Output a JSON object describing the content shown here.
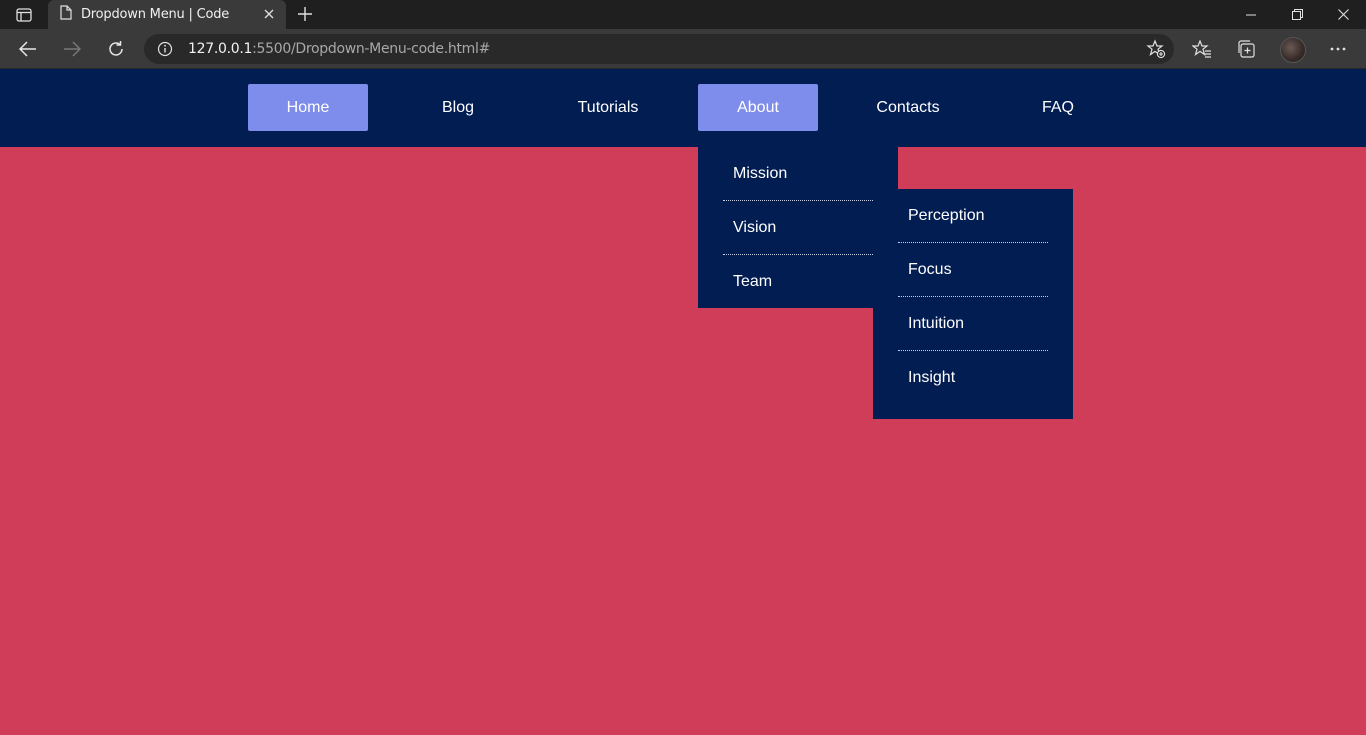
{
  "browser": {
    "tab_title": "Dropdown Menu | Code",
    "url_host": "127.0.0.1",
    "url_rest": ":5500/Dropdown-Menu-code.html#"
  },
  "icons": {
    "tab_actions": "tab-actions-icon",
    "page": "page-icon",
    "close": "close-icon",
    "new_tab": "plus-icon",
    "back": "arrow-left-icon",
    "forward": "arrow-right-icon",
    "reload": "reload-icon",
    "info": "info-icon",
    "add_favorite": "star-plus-icon",
    "favorites": "favorites-icon",
    "collections": "collections-icon",
    "menu": "ellipsis-icon"
  },
  "colors": {
    "page_background": "#d03d58",
    "navbar_background": "#021d52",
    "active_item": "#7e8ceb"
  },
  "nav": {
    "items": [
      {
        "label": "Home",
        "active": true
      },
      {
        "label": "Blog",
        "active": false
      },
      {
        "label": "Tutorials",
        "active": false
      },
      {
        "label": "About",
        "active": true
      },
      {
        "label": "Contacts",
        "active": false
      },
      {
        "label": "FAQ",
        "active": false
      }
    ]
  },
  "dropdown": {
    "items": [
      {
        "label": "Mission"
      },
      {
        "label": "Vision"
      },
      {
        "label": "Team"
      }
    ]
  },
  "subdropdown": {
    "items": [
      {
        "label": "Perception"
      },
      {
        "label": "Focus"
      },
      {
        "label": "Intuition"
      },
      {
        "label": "Insight"
      }
    ]
  }
}
